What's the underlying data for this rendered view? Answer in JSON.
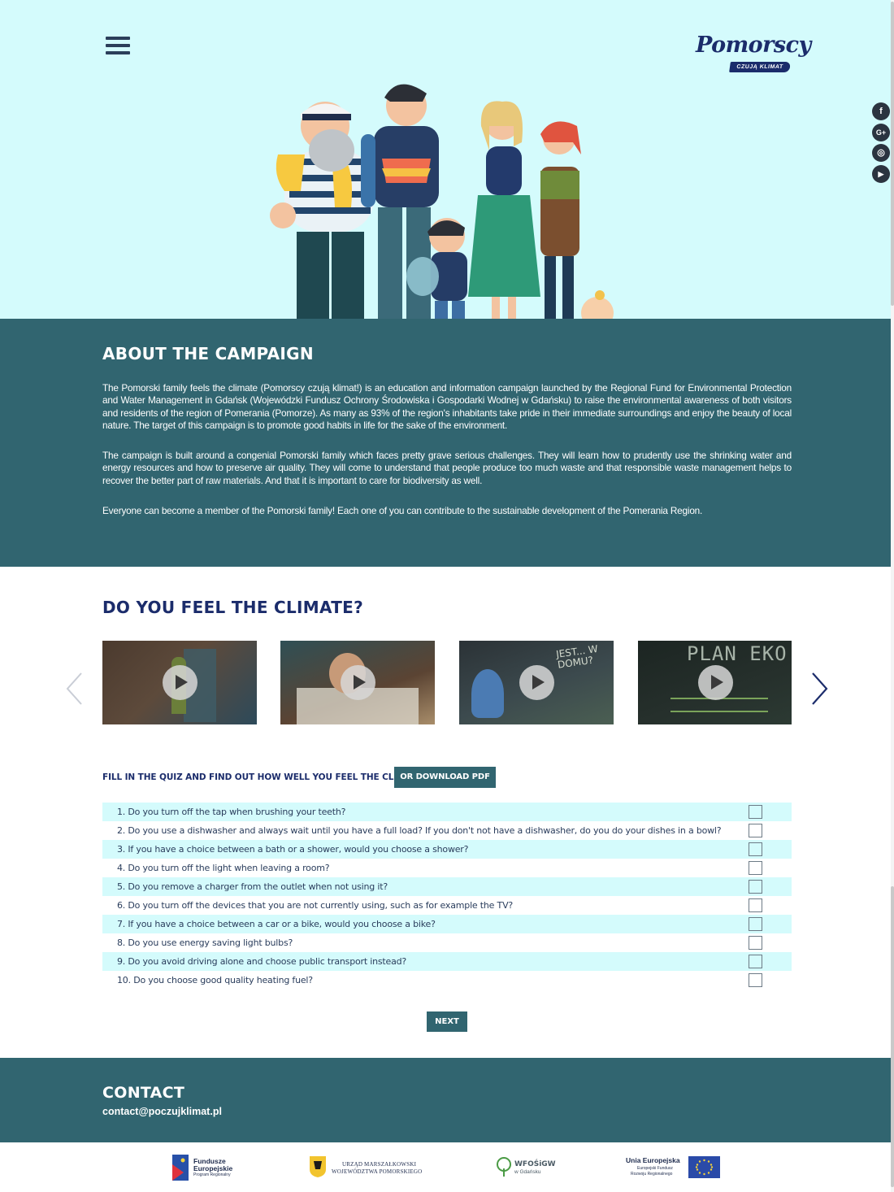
{
  "header": {
    "logo": {
      "word": "Pomorscy",
      "tagline": "CZUJĄ KLIMAT"
    },
    "menu_icon": "hamburger-icon",
    "socials": [
      {
        "name": "facebook-icon",
        "glyph": "f"
      },
      {
        "name": "google-plus-icon",
        "glyph": "G+"
      },
      {
        "name": "instagram-icon",
        "glyph": "◎"
      },
      {
        "name": "youtube-icon",
        "glyph": "▶"
      }
    ]
  },
  "about": {
    "title": "ABOUT THE CAMPAIGN",
    "paragraphs": [
      "The Pomorski family feels the climate (Pomorscy czują klimat!) is an education and information campaign launched by the Regional Fund for Environmental Protection and Water Management in Gdańsk (Wojewódzki Fundusz Ochrony Środowiska i Gospodarki Wodnej w Gdańsku) to raise the environmental awareness of both visitors and residents of the region of Pomerania (Pomorze). As many as 93% of the region's inhabitants take pride in their immediate surroundings and enjoy the beauty of local nature. The target of this campaign is to promote good habits in life for the sake of the environment.",
      "The campaign is built around a congenial Pomorski family which faces pretty grave serious challenges. They will learn how to prudently use the shrinking water and energy resources and how to preserve air quality. They will come to understand that people produce too much waste and that responsible waste management helps to recover the better part of raw materials. And that it is important to care for biodiversity as well.",
      "Everyone can become a member of the Pomorski family! Each one of you can contribute to the sustainable development of the Pomerania Region."
    ]
  },
  "climate": {
    "title": "DO YOU FEEL THE CLIMATE?",
    "videos": [
      {
        "name": "video-1",
        "overlay": ""
      },
      {
        "name": "video-2",
        "overlay": ""
      },
      {
        "name": "video-3",
        "overlay": "JEST... W DOMU?"
      },
      {
        "name": "video-4",
        "overlay": "PLAN EKO"
      }
    ]
  },
  "quiz": {
    "title": "FILL IN THE QUIZ AND FIND OUT HOW WELL YOU FEEL THE CLIMATE",
    "pdf_label": "OR DOWNLOAD PDF",
    "questions": [
      "1. Do you turn off the tap when brushing your teeth?",
      "2. Do you use a dishwasher and always wait until you have a full load? If you don't not have a dishwasher, do you do your dishes in a bowl?",
      "3. If you have a choice between a bath or a shower, would you choose a shower?",
      "4. Do you turn off the light when leaving a room?",
      "5. Do you remove a charger from the outlet when not using it?",
      "6. Do you turn off the devices that you are not currently using, such as for example the TV?",
      "7. If you have a choice between a car or a bike, would you choose a bike?",
      "8. Do you use energy saving light bulbs?",
      "9. Do you avoid driving alone and choose public transport instead?",
      "10. Do you choose good quality heating fuel?"
    ],
    "next_label": "NEXT"
  },
  "contact": {
    "title": "CONTACT",
    "email": "contact@poczujklimat.pl"
  },
  "sponsors": {
    "fe": {
      "line1": "Fundusze",
      "line2": "Europejskie",
      "line3": "Program Regionalny"
    },
    "umwp": {
      "line1": "URZĄD MARSZAŁKOWSKI",
      "line2": "WOJEWÓDZTWA POMORSKIEGO"
    },
    "wfos": {
      "line1": "WFOŚiGW",
      "line2": "w Gdańsku"
    },
    "ue": {
      "line1": "Unia Europejska",
      "line2": "Europejski Fundusz",
      "line3": "Rozwoju Regionalnego"
    }
  },
  "colors": {
    "hero_bg": "#d4fbfc",
    "teal": "#316570",
    "navy": "#1b2c6b",
    "row_alt": "#d4fbfc"
  }
}
